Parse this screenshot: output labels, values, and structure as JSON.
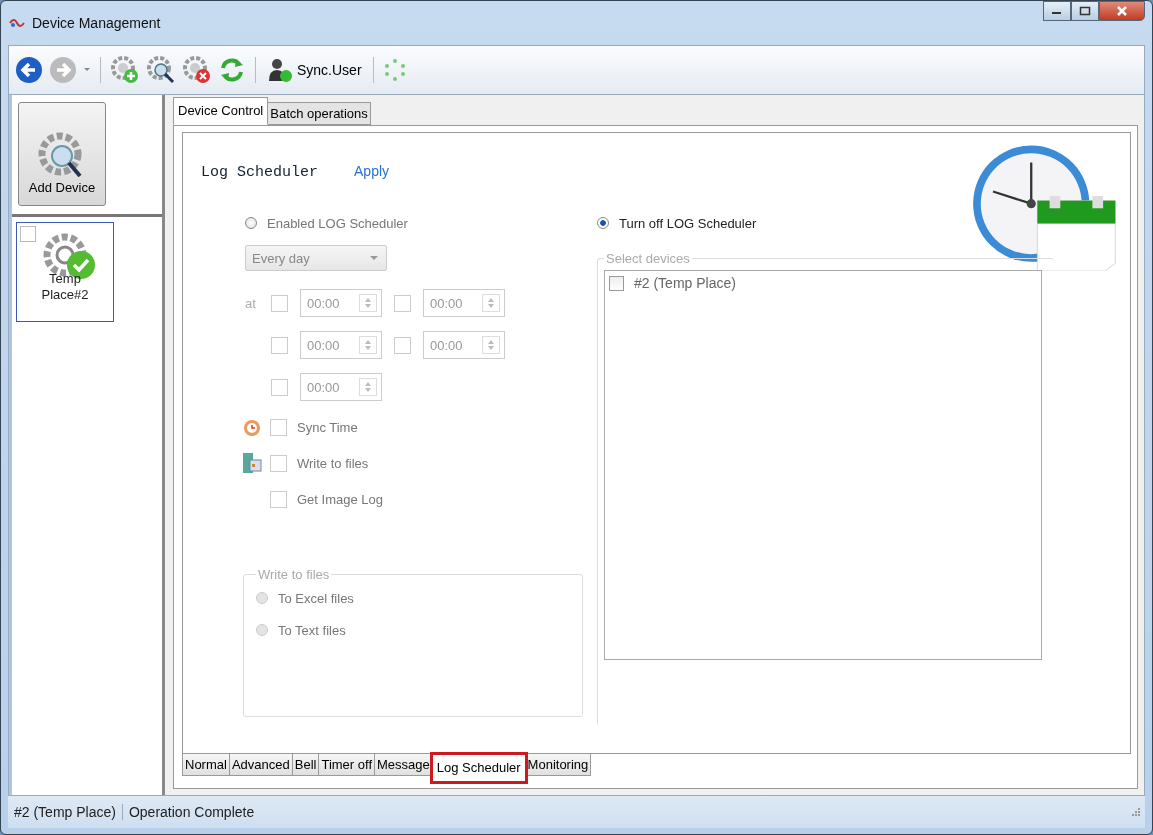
{
  "window": {
    "title": "Device Management"
  },
  "toolbar": {
    "sync_user": "Sync.User"
  },
  "sidebar": {
    "add_device": "Add Device",
    "devices": [
      {
        "label": "Temp Place#2",
        "checked": false,
        "selected": true
      }
    ]
  },
  "top_tabs": [
    {
      "label": "Device Control",
      "selected": true
    },
    {
      "label": "Batch operations",
      "selected": false
    }
  ],
  "panel": {
    "title": "Log Scheduler",
    "apply": "Apply",
    "enable_option": {
      "label": "Enabled LOG Scheduler",
      "selected": false
    },
    "off_option": {
      "label": "Turn off LOG Scheduler",
      "selected": true
    },
    "schedule": {
      "disabled": true,
      "frequency": "Every day",
      "at_label": "at",
      "time_slots": [
        {
          "value": "00:00",
          "checked": false
        },
        {
          "value": "00:00",
          "checked": false
        },
        {
          "value": "00:00",
          "checked": false
        },
        {
          "value": "00:00",
          "checked": false
        },
        {
          "value": "00:00",
          "checked": false
        }
      ],
      "options": [
        {
          "kind": "alarm",
          "label": "Sync Time",
          "checked": false
        },
        {
          "kind": "file",
          "label": "Write to files",
          "checked": false
        },
        {
          "kind": "plain",
          "label": "Get Image Log",
          "checked": false
        }
      ],
      "write_group": {
        "legend": "Write to files",
        "options": [
          {
            "label": "To Excel files",
            "selected": false
          },
          {
            "label": "To Text files",
            "selected": false
          }
        ]
      }
    },
    "devices_group": {
      "legend": "Select devices",
      "items": [
        {
          "label": "#2 (Temp Place)",
          "checked": false
        }
      ]
    }
  },
  "bottom_tabs": [
    {
      "label": "Normal",
      "selected": false
    },
    {
      "label": "Advanced",
      "selected": false
    },
    {
      "label": "Bell",
      "selected": false
    },
    {
      "label": "Timer off",
      "selected": false
    },
    {
      "label": "Message",
      "selected": false
    },
    {
      "label": "Log Scheduler",
      "selected": true
    },
    {
      "label": "Monitoring",
      "selected": false
    }
  ],
  "status_bar": [
    "#2 (Temp Place)",
    "Operation Complete"
  ]
}
